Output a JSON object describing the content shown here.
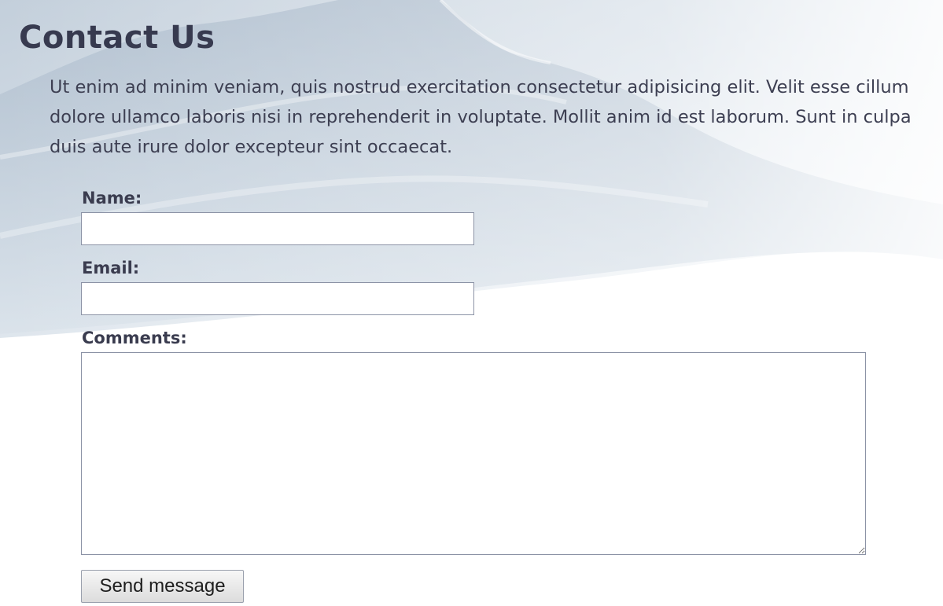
{
  "page": {
    "title": "Contact Us",
    "intro": "Ut enim ad minim veniam, quis nostrud exercitation consectetur adipisicing elit. Velit esse cillum dolore ullamco laboris nisi in reprehenderit in voluptate. Mollit anim id est laborum. Sunt in culpa duis aute irure dolor excepteur sint occaecat."
  },
  "form": {
    "name_label": "Name:",
    "name_value": "",
    "email_label": "Email:",
    "email_value": "",
    "comments_label": "Comments:",
    "comments_value": "",
    "submit_label": "Send message"
  },
  "colors": {
    "heading": "#373a4f",
    "text": "#3d3f52",
    "field_border": "#8c93a6",
    "background_tint": "#b9c6d4"
  }
}
